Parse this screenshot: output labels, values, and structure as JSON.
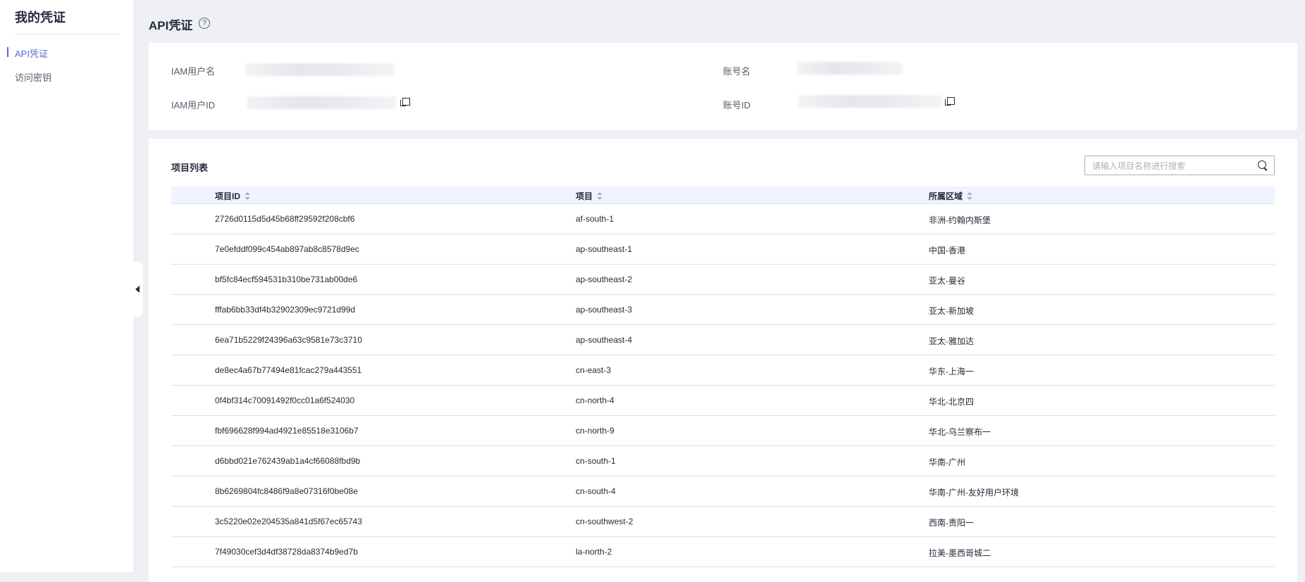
{
  "sidebar": {
    "title": "我的凭证",
    "items": [
      {
        "label": "API凭证",
        "active": true
      },
      {
        "label": "访问密钥",
        "active": false
      }
    ]
  },
  "page": {
    "title": "API凭证",
    "help_icon": "?"
  },
  "info": {
    "iam_username_label": "IAM用户名",
    "account_name_label": "账号名",
    "iam_user_id_label": "IAM用户ID",
    "account_id_label": "账号ID"
  },
  "projects": {
    "title": "项目列表",
    "search_placeholder": "请输入项目名称进行搜索",
    "columns": [
      "项目ID",
      "项目",
      "所属区域"
    ],
    "rows": [
      {
        "id": "2726d0115d5d45b68ff29592f208cbf6",
        "project": "af-south-1",
        "region": "非洲-约翰内斯堡"
      },
      {
        "id": "7e0efddf099c454ab897ab8c8578d9ec",
        "project": "ap-southeast-1",
        "region": "中国-香港"
      },
      {
        "id": "bf5fc84ecf594531b310be731ab00de6",
        "project": "ap-southeast-2",
        "region": "亚太-曼谷"
      },
      {
        "id": "fffab6bb33df4b32902309ec9721d99d",
        "project": "ap-southeast-3",
        "region": "亚太-新加坡"
      },
      {
        "id": "6ea71b5229f24396a63c9581e73c3710",
        "project": "ap-southeast-4",
        "region": "亚太-雅加达"
      },
      {
        "id": "de8ec4a67b77494e81fcac279a443551",
        "project": "cn-east-3",
        "region": "华东-上海一"
      },
      {
        "id": "0f4bf314c70091492f0cc01a6f524030",
        "project": "cn-north-4",
        "region": "华北-北京四"
      },
      {
        "id": "fbf696628f994ad4921e85518e3106b7",
        "project": "cn-north-9",
        "region": "华北-乌兰察布一"
      },
      {
        "id": "d6bbd021e762439ab1a4cf66088fbd9b",
        "project": "cn-south-1",
        "region": "华南-广州"
      },
      {
        "id": "8b6269804fc8486f9a8e07316f0be08e",
        "project": "cn-south-4",
        "region": "华南-广州-友好用户环境"
      },
      {
        "id": "3c5220e02e204535a841d5f67ec65743",
        "project": "cn-southwest-2",
        "region": "西南-贵阳一"
      },
      {
        "id": "7f49030cef3d4df38728da8374b9ed7b",
        "project": "la-north-2",
        "region": "拉美-墨西哥城二"
      }
    ]
  }
}
